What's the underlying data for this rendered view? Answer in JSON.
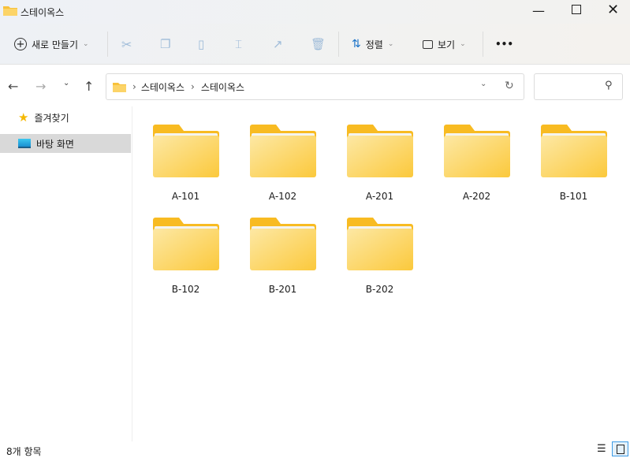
{
  "window": {
    "title": "스테이옥스"
  },
  "toolbar": {
    "new_label": "새로 만들기",
    "sort_label": "정렬",
    "view_label": "보기",
    "more": "•••"
  },
  "address": {
    "crumbs": [
      "스테이옥스",
      "스테이옥스"
    ],
    "sep": "›"
  },
  "sidebar": {
    "items": [
      {
        "label": "즐겨찾기"
      },
      {
        "label": "바탕 화면"
      }
    ]
  },
  "folders": [
    {
      "name": "A-101"
    },
    {
      "name": "A-102"
    },
    {
      "name": "A-201"
    },
    {
      "name": "A-202"
    },
    {
      "name": "B-101"
    },
    {
      "name": "B-102"
    },
    {
      "name": "B-201"
    },
    {
      "name": "B-202"
    }
  ],
  "status": {
    "count": "8개 항목"
  }
}
